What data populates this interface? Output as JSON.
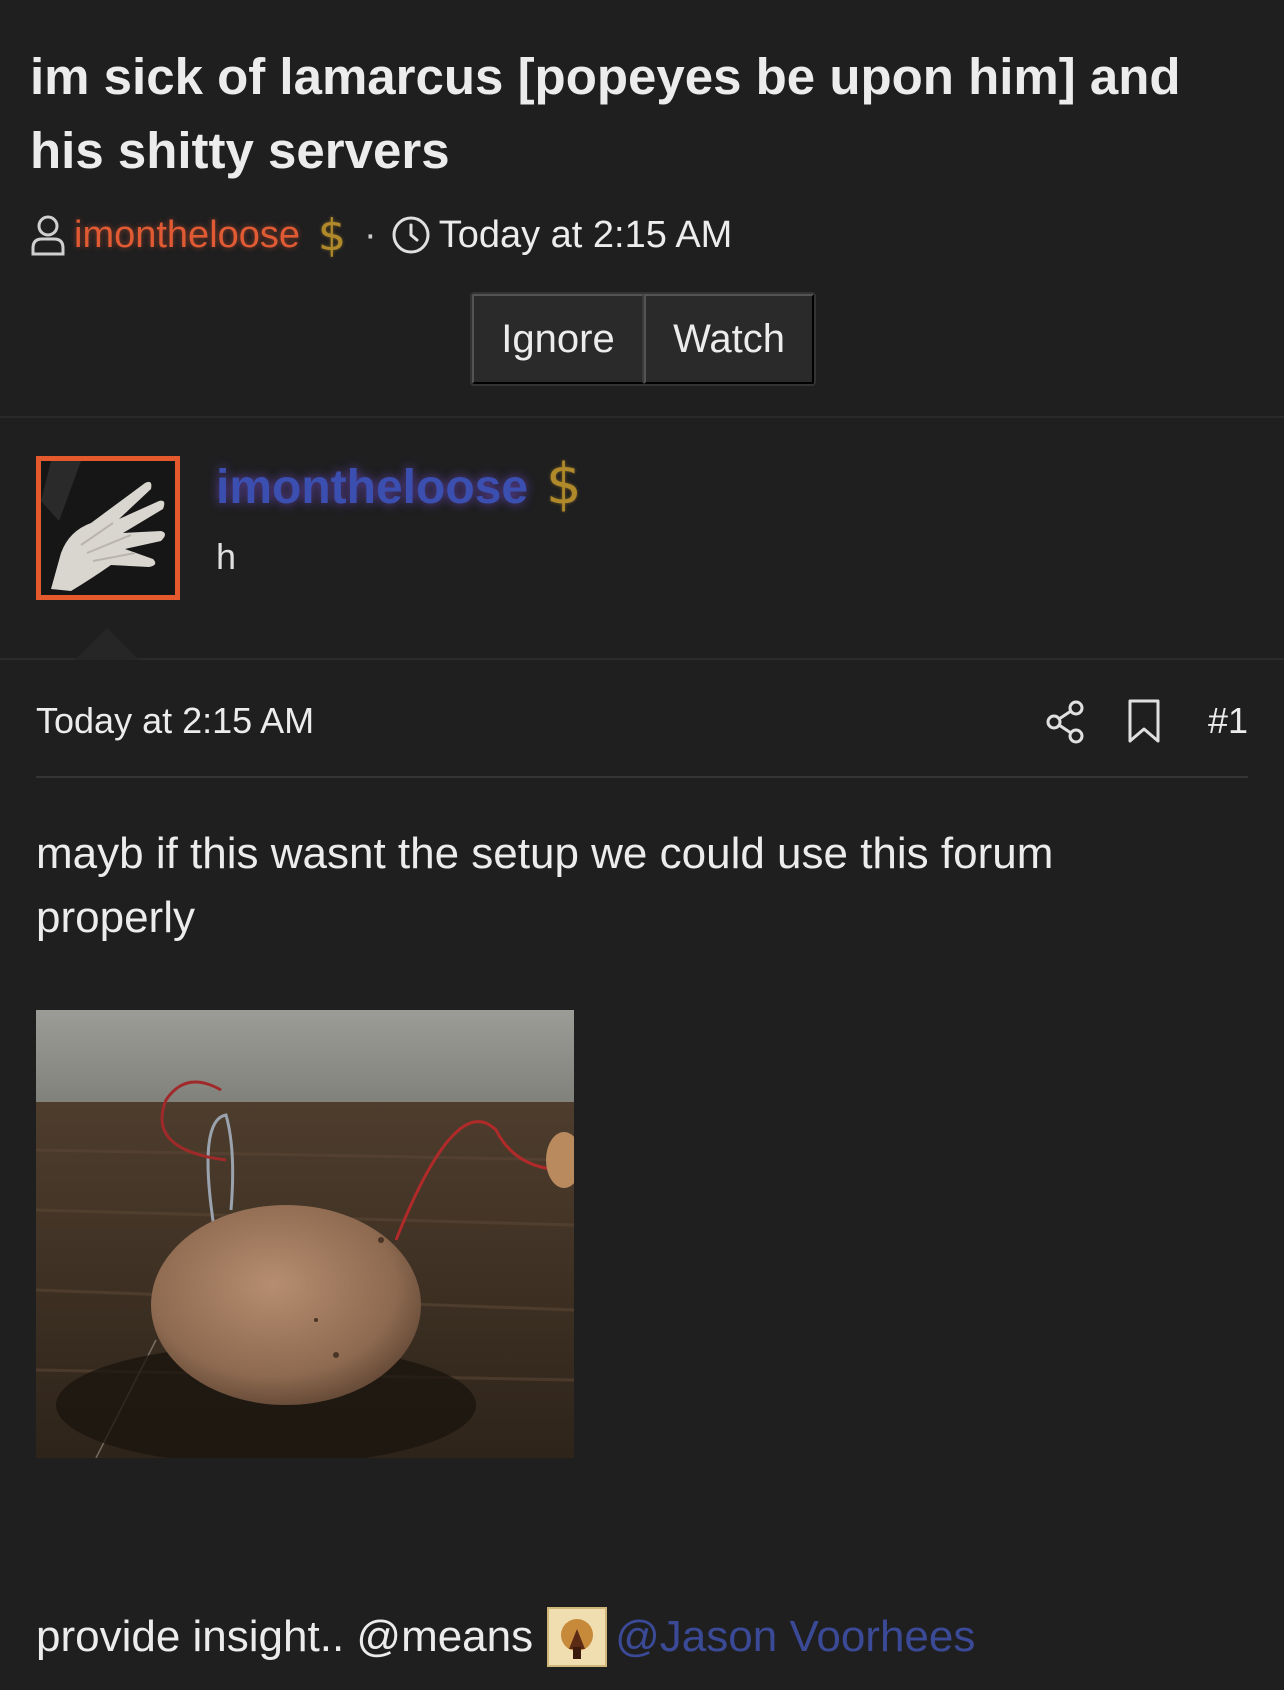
{
  "thread": {
    "title": "im sick of lamarcus [popeyes be upon him] and his shitty servers",
    "author": "imontheloose",
    "author_badge_icon": "dollar-icon",
    "separator": "·",
    "time": "Today at 2:15 AM",
    "buttons": {
      "ignore": "Ignore",
      "watch": "Watch"
    }
  },
  "post": {
    "author": "imontheloose",
    "author_title": "h",
    "time": "Today at 2:15 AM",
    "number": "#1",
    "body": "mayb if this wasnt the setup we could use this forum properly",
    "image_alt": "potato with wires stuck into it on a wooden table",
    "footer": {
      "text": "provide insight.. @means",
      "mention": "@Jason Voorhees"
    }
  },
  "colors": {
    "background": "#1f1f20",
    "username_orange": "#e05a33",
    "username_blue": "#3a4fb0",
    "gold_badge": "#b08a2a",
    "mention_link": "#3b4a96"
  }
}
